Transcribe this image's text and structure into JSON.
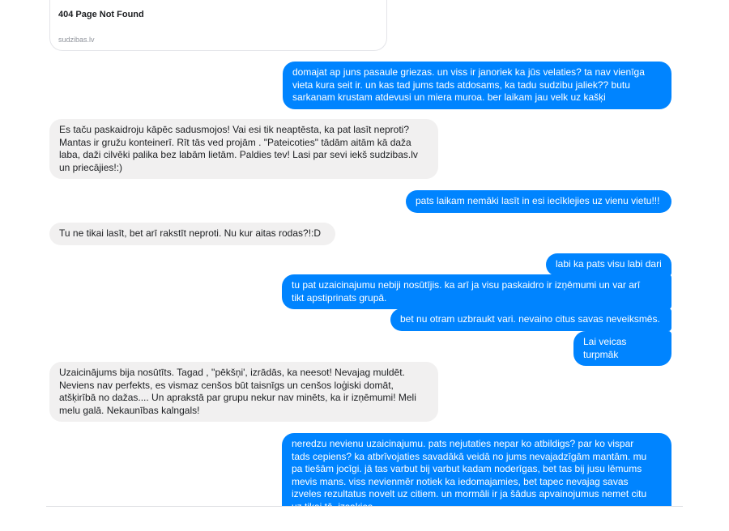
{
  "link_preview": {
    "title": "404 Page Not Found",
    "domain": "sudzibas.lv"
  },
  "messages": [
    {
      "direction": "out",
      "text": "domajat ap juns pasaule griezas. un viss ir janoriek ka jūs velaties? ta nav vienīga\nvieta kura seit ir. un kas tad jums tads atdosams, ka tadu sudzibu jaliek?? butu\nsarkanam krustam atdevusi un miera muroa. ber laikam jau velk uz kašķi"
    },
    {
      "direction": "in",
      "text": "Es taču paskaidroju kāpēc sadusmojos! Vai esi tik neaptēsta, ka pat lasīt neproti?\nMantas ir gružu konteinerī.  Rīt tās ved projām . \"Pateicoties\" tādām aitām kā daža\nlaba, daži cilvēki palika bez labām lietām. Paldies tev!  Lasi par sevi  iekš sudzibas.lv\nun priecājies!:)"
    },
    {
      "direction": "out",
      "text": "pats laikam nemāki lasīt in esi iecīklejies uz vienu vietu!!!"
    },
    {
      "direction": "in",
      "text": "Tu ne tikai lasīt, bet arī rakstīt neproti.  Nu kur aitas rodas?!:D"
    },
    {
      "direction": "out",
      "text": "labi ka pats visu labi dari"
    },
    {
      "direction": "out",
      "text": "tu pat uzaicinajumu nebiji nosūtījis. ka arī ja visu paskaidro ir izņēmumi un var arī\ntikt apstiprinats grupā."
    },
    {
      "direction": "out",
      "text": "bet nu otram uzbraukt vari. nevaino citus savas neveiksmēs."
    },
    {
      "direction": "out",
      "text": "Lai veicas turpmāk"
    },
    {
      "direction": "in",
      "text": "Uzaicinājums bija nosūtīts. Tagad , ''pēkšņi', izrādās, ka neesot! Nevajag muldēt.\nNeviens nav perfekts, es vismaz cenšos būt taisnīgs un cenšos loģiski domāt,\natšķirībā no dažas.... Un aprakstā par grupu nekur nav minēts, ka ir izņēmumi! Meli\nmelu galā. Nekaunības kalngals!"
    },
    {
      "direction": "out",
      "text": "neredzu nevienu uzaicinajumu. pats nejutaties nepar ko atbildigs? par ko vispar\ntads cepiens? ka atbrīvojaties savadākā veidā no jums nevajadzīgām mantām. mu\npa tiešām jocīgi. jā tas varbut bij varbut kadam noderīgas, bet tas bij jusu lēmums\nmevis mans. viss nevienmēr notiek ka iedomajamies, bet tapec nevajag savas\nizveles rezultatus novelt uz citiem.  un mormāli ir ja šādus apvainojumus nemet citu\nuz tikai tā, izsakies."
    }
  ]
}
